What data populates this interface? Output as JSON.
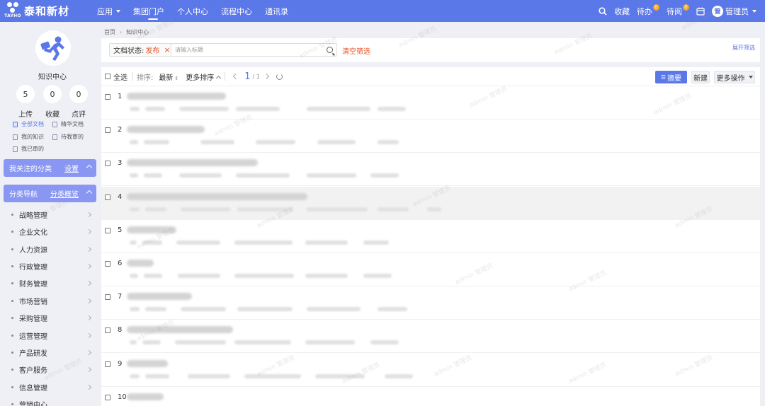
{
  "header": {
    "logo_sub": "TAYHO",
    "brand": "泰和新材",
    "nav": [
      {
        "label": "应用",
        "dropdown": true,
        "active": false
      },
      {
        "label": "集团门户",
        "active": true
      },
      {
        "label": "个人中心",
        "active": false
      },
      {
        "label": "流程中心",
        "active": false
      },
      {
        "label": "通讯录",
        "active": false
      }
    ],
    "favorites": "收藏",
    "todo": "待办",
    "todo_count": "0",
    "toread": "待阅",
    "toread_count": "0",
    "user": "管理员"
  },
  "sidebar": {
    "title": "知识中心",
    "stats": [
      {
        "value": "5",
        "label": "上传"
      },
      {
        "value": "0",
        "label": "收藏"
      },
      {
        "value": "0",
        "label": "点评"
      }
    ],
    "quick_links": [
      "全部文档",
      "精华文档",
      "我的知识",
      "待我审的",
      "我已审的"
    ],
    "followed_section": {
      "title": "我关注的分类",
      "link": "设置"
    },
    "nav_section": {
      "title": "分类导航",
      "link": "分类概览"
    },
    "categories": [
      "战略管理",
      "企业文化",
      "人力资源",
      "行政管理",
      "财务管理",
      "市场营销",
      "采购管理",
      "运营管理",
      "产品研发",
      "客户服务",
      "信息管理",
      "营销中心"
    ]
  },
  "breadcrumb": {
    "home": "首页",
    "current": "知识中心"
  },
  "filter": {
    "status_label": "文档状态:",
    "status_value": "发布",
    "search_placeholder": "请输入标题",
    "clear": "清空筛选",
    "expand": "展开筛选"
  },
  "toolbar": {
    "select_all": "全选",
    "sort_label": "排序:",
    "sort_value": "最新",
    "more_sort": "更多排序",
    "page_current": "1",
    "page_total": "/ 1",
    "summary": "摘要",
    "new": "新建",
    "more_ops": "更多操作"
  },
  "rows": [
    {
      "num": "1"
    },
    {
      "num": "2"
    },
    {
      "num": "3"
    },
    {
      "num": "4"
    },
    {
      "num": "5"
    },
    {
      "num": "6"
    },
    {
      "num": "7"
    },
    {
      "num": "8"
    },
    {
      "num": "9"
    },
    {
      "num": "10"
    }
  ],
  "watermark": "admin 管理员",
  "colors": {
    "primary": "#5b78e8",
    "section": "#8a97f2",
    "accent": "#e5582e",
    "badge": "#f5a623"
  }
}
